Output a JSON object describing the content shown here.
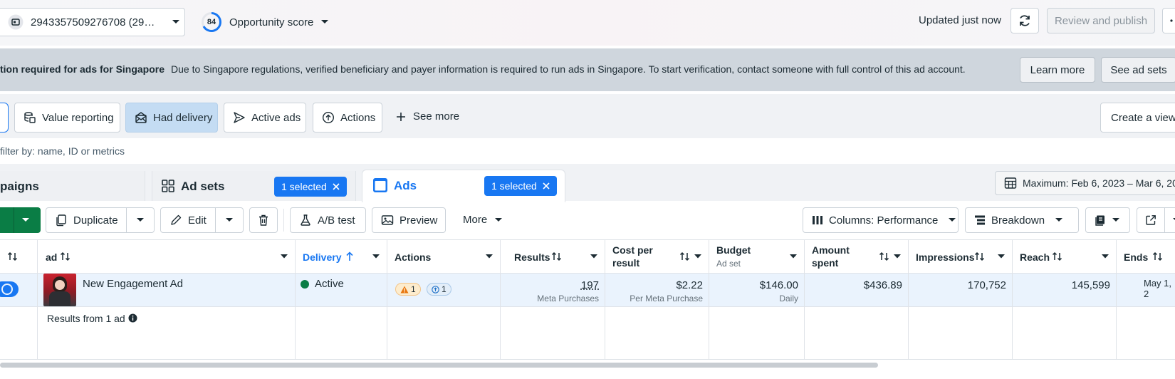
{
  "topbar": {
    "account_label": "2943357509276708 (29…",
    "score_value": "84",
    "score_label": "Opportunity score",
    "updated_text": "Updated just now",
    "review_label": "Review and publish"
  },
  "banner": {
    "title": "tion required for ads for Singapore",
    "text": "Due to Singapore regulations, verified beneficiary and payer information is required to run ads in Singapore. To start verification, contact someone with full control of this ad account.",
    "learn_more": "Learn more",
    "see_adsets": "See ad sets"
  },
  "chips": {
    "value_reporting": "Value reporting",
    "had_delivery": "Had delivery",
    "active_ads": "Active ads",
    "actions": "Actions",
    "see_more": "See more",
    "create_view": "Create a view"
  },
  "search": {
    "placeholder": "filter by: name, ID or metrics"
  },
  "tabs": {
    "campaigns": "paigns",
    "adsets": "Ad sets",
    "adsets_selected": "1 selected",
    "ads": "Ads",
    "ads_selected": "1 selected",
    "date_range": "Maximum: Feb 6, 2023 – Mar 6, 20"
  },
  "toolbar": {
    "duplicate": "Duplicate",
    "edit": "Edit",
    "ab_test": "A/B test",
    "preview": "Preview",
    "more": "More",
    "columns": "Columns: Performance",
    "breakdown": "Breakdown"
  },
  "table": {
    "headers": {
      "ad": "ad",
      "delivery": "Delivery",
      "actions": "Actions",
      "results": "Results",
      "cost_per_result_1": "Cost per",
      "cost_per_result_2": "result",
      "budget": "Budget",
      "budget_sub": "Ad set",
      "amount_spent_1": "Amount",
      "amount_spent_2": "spent",
      "impressions": "Impressions",
      "reach": "Reach",
      "ends": "Ends"
    },
    "row": {
      "name": "New Engagement Ad",
      "delivery": "Active",
      "warn_count": "1",
      "info_count": "1",
      "results": "197",
      "results_sub": "Meta Purchases",
      "cost": "$2.22",
      "cost_sub": "Per Meta Purchase",
      "budget": "$146.00",
      "budget_sub": "Daily",
      "spent": "$436.89",
      "impressions": "170,752",
      "reach": "145,599",
      "ends": "May 1, 2"
    },
    "summary": {
      "label": "Results from 1 ad"
    }
  },
  "colors": {
    "primary": "#1877f2",
    "create_green": "#0a7d45",
    "active_dot": "#0a7d45",
    "warning": "#e8770e"
  }
}
